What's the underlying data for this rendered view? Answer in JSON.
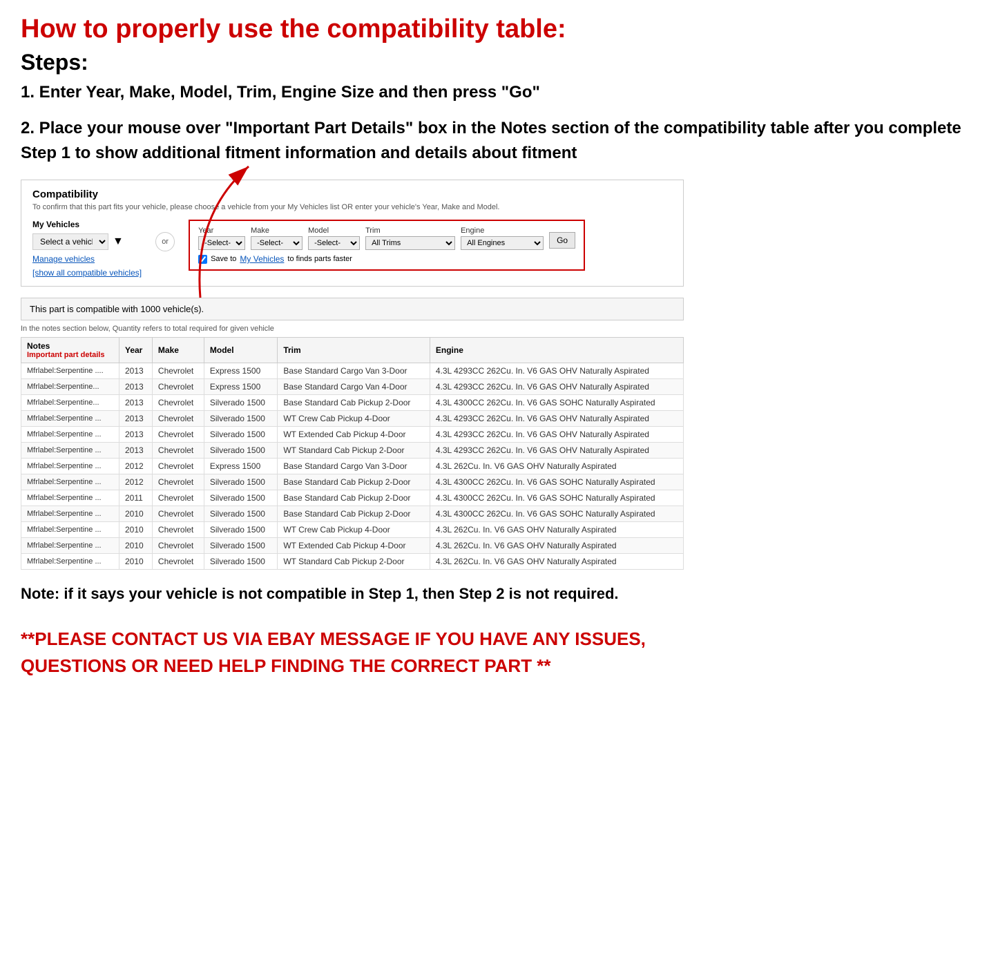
{
  "page": {
    "main_title": "How to properly use the compatibility table:",
    "steps_label": "Steps:",
    "step1": "1. Enter Year, Make, Model, Trim, Engine Size and then press \"Go\"",
    "step2": "2. Place your mouse over \"Important Part Details\" box in the Notes section of the compatibility table after you complete Step 1 to show additional fitment information and details about fitment",
    "note_text": "Note: if it says your vehicle is not compatible in Step 1, then Step 2 is not required.",
    "contact_msg": "**PLEASE CONTACT US VIA EBAY MESSAGE IF YOU HAVE ANY ISSUES, QUESTIONS OR NEED HELP FINDING THE CORRECT PART **"
  },
  "compatibility_section": {
    "title": "Compatibility",
    "subtitle": "To confirm that this part fits your vehicle, please choose a vehicle from your My Vehicles list OR enter your vehicle's Year, Make and Model.",
    "my_vehicles_label": "My Vehicles",
    "select_vehicle_placeholder": "Select a vehicle",
    "manage_vehicles": "Manage vehicles",
    "show_all": "[show all compatible vehicles]",
    "or_label": "or",
    "year_label": "Year",
    "make_label": "Make",
    "model_label": "Model",
    "trim_label": "Trim",
    "engine_label": "Engine",
    "year_value": "-Select-",
    "make_value": "-Select-",
    "model_value": "-Select-",
    "trim_value": "All Trims",
    "engine_value": "All Engines",
    "go_label": "Go",
    "save_label": "Save to",
    "save_link": "My Vehicles",
    "save_suffix": "to finds parts faster",
    "compatible_count_msg": "This part is compatible with 1000 vehicle(s).",
    "quantity_note": "In the notes section below, Quantity refers to total required for given vehicle"
  },
  "table": {
    "headers": [
      "Notes",
      "Year",
      "Make",
      "Model",
      "Trim",
      "Engine"
    ],
    "notes_sub": "Important part details",
    "rows": [
      {
        "notes": "Mfrlabel:Serpentine ....",
        "year": "2013",
        "make": "Chevrolet",
        "model": "Express 1500",
        "trim": "Base Standard Cargo Van 3-Door",
        "engine": "4.3L 4293CC 262Cu. In. V6 GAS OHV Naturally Aspirated"
      },
      {
        "notes": "Mfrlabel:Serpentine...",
        "year": "2013",
        "make": "Chevrolet",
        "model": "Express 1500",
        "trim": "Base Standard Cargo Van 4-Door",
        "engine": "4.3L 4293CC 262Cu. In. V6 GAS OHV Naturally Aspirated"
      },
      {
        "notes": "Mfrlabel:Serpentine...",
        "year": "2013",
        "make": "Chevrolet",
        "model": "Silverado 1500",
        "trim": "Base Standard Cab Pickup 2-Door",
        "engine": "4.3L 4300CC 262Cu. In. V6 GAS SOHC Naturally Aspirated"
      },
      {
        "notes": "Mfrlabel:Serpentine ...",
        "year": "2013",
        "make": "Chevrolet",
        "model": "Silverado 1500",
        "trim": "WT Crew Cab Pickup 4-Door",
        "engine": "4.3L 4293CC 262Cu. In. V6 GAS OHV Naturally Aspirated"
      },
      {
        "notes": "Mfrlabel:Serpentine ...",
        "year": "2013",
        "make": "Chevrolet",
        "model": "Silverado 1500",
        "trim": "WT Extended Cab Pickup 4-Door",
        "engine": "4.3L 4293CC 262Cu. In. V6 GAS OHV Naturally Aspirated"
      },
      {
        "notes": "Mfrlabel:Serpentine ...",
        "year": "2013",
        "make": "Chevrolet",
        "model": "Silverado 1500",
        "trim": "WT Standard Cab Pickup 2-Door",
        "engine": "4.3L 4293CC 262Cu. In. V6 GAS OHV Naturally Aspirated"
      },
      {
        "notes": "Mfrlabel:Serpentine ...",
        "year": "2012",
        "make": "Chevrolet",
        "model": "Express 1500",
        "trim": "Base Standard Cargo Van 3-Door",
        "engine": "4.3L 262Cu. In. V6 GAS OHV Naturally Aspirated"
      },
      {
        "notes": "Mfrlabel:Serpentine ...",
        "year": "2012",
        "make": "Chevrolet",
        "model": "Silverado 1500",
        "trim": "Base Standard Cab Pickup 2-Door",
        "engine": "4.3L 4300CC 262Cu. In. V6 GAS SOHC Naturally Aspirated"
      },
      {
        "notes": "Mfrlabel:Serpentine ...",
        "year": "2011",
        "make": "Chevrolet",
        "model": "Silverado 1500",
        "trim": "Base Standard Cab Pickup 2-Door",
        "engine": "4.3L 4300CC 262Cu. In. V6 GAS SOHC Naturally Aspirated"
      },
      {
        "notes": "Mfrlabel:Serpentine ...",
        "year": "2010",
        "make": "Chevrolet",
        "model": "Silverado 1500",
        "trim": "Base Standard Cab Pickup 2-Door",
        "engine": "4.3L 4300CC 262Cu. In. V6 GAS SOHC Naturally Aspirated"
      },
      {
        "notes": "Mfrlabel:Serpentine ...",
        "year": "2010",
        "make": "Chevrolet",
        "model": "Silverado 1500",
        "trim": "WT Crew Cab Pickup 4-Door",
        "engine": "4.3L 262Cu. In. V6 GAS OHV Naturally Aspirated"
      },
      {
        "notes": "Mfrlabel:Serpentine ...",
        "year": "2010",
        "make": "Chevrolet",
        "model": "Silverado 1500",
        "trim": "WT Extended Cab Pickup 4-Door",
        "engine": "4.3L 262Cu. In. V6 GAS OHV Naturally Aspirated"
      },
      {
        "notes": "Mfrlabel:Serpentine ...",
        "year": "2010",
        "make": "Chevrolet",
        "model": "Silverado 1500",
        "trim": "WT Standard Cab Pickup 2-Door",
        "engine": "4.3L 262Cu. In. V6 GAS OHV Naturally Aspirated"
      }
    ]
  }
}
